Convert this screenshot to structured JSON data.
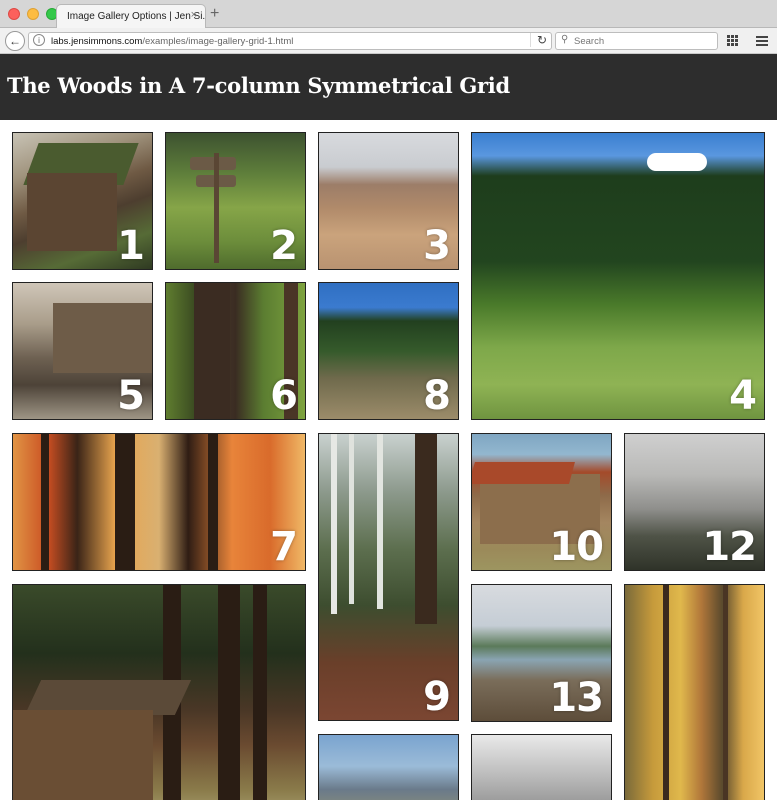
{
  "browser": {
    "tab_title": "Image Gallery Options | Jen Si...",
    "tab_close": "×",
    "new_tab": "+",
    "url_host": "labs.jensimmons.com",
    "url_path": "/examples/image-gallery-grid-1.html",
    "search_placeholder": "Search",
    "icons": [
      "back-arrow-icon",
      "info-icon",
      "reload-icon",
      "search-icon",
      "grid-icon",
      "menu-icon"
    ]
  },
  "page": {
    "title": "The Woods in A 7-column Symmetrical Grid",
    "header_bg": "#2d2d2d"
  },
  "gallery": {
    "tiles": [
      {
        "label": "1"
      },
      {
        "label": "2"
      },
      {
        "label": "3"
      },
      {
        "label": "4"
      },
      {
        "label": "5"
      },
      {
        "label": "6"
      },
      {
        "label": "8"
      },
      {
        "label": "7"
      },
      {
        "label": "9"
      },
      {
        "label": "10"
      },
      {
        "label": "12"
      },
      {
        "label": "13"
      }
    ]
  }
}
